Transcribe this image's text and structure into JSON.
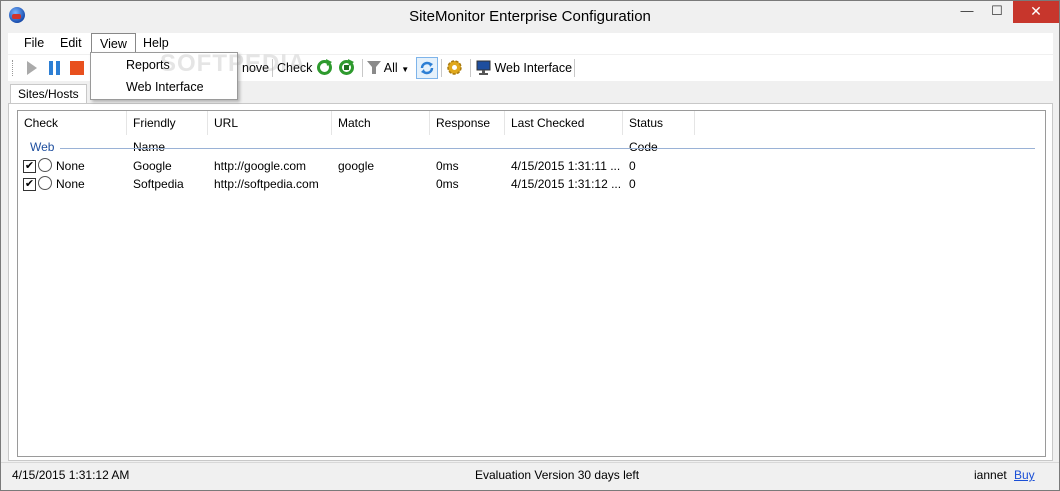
{
  "window": {
    "title": "SiteMonitor Enterprise Configuration",
    "minimize_glyph": "—",
    "maximize_glyph": "☐",
    "close_glyph": "✕"
  },
  "menu": {
    "file": "File",
    "edit": "Edit",
    "view": "View",
    "help": "Help"
  },
  "view_menu": {
    "items": [
      "Reports",
      "Web Interface"
    ]
  },
  "toolbar": {
    "remove_partial": "nove",
    "check": "Check",
    "filter": "All",
    "web_interface": "Web Interface"
  },
  "tabs": {
    "sites": "Sites/Hosts"
  },
  "table": {
    "columns": [
      "Check",
      "Friendly Name",
      "URL",
      "Match",
      "Response",
      "Last Checked",
      "Status Code"
    ],
    "group": "Web",
    "rows": [
      {
        "checked": true,
        "check": "None",
        "name": "Google",
        "url": "http://google.com",
        "match": "google",
        "response": "0ms",
        "last_checked": "4/15/2015 1:31:11 ...",
        "status": "0"
      },
      {
        "checked": true,
        "check": "None",
        "name": "Softpedia",
        "url": "http://softpedia.com",
        "match": "",
        "response": "0ms",
        "last_checked": "4/15/2015 1:31:12 ...",
        "status": "0"
      }
    ]
  },
  "status": {
    "time": "4/15/2015 1:31:12 AM",
    "eval": "Evaluation Version 30 days left",
    "user": "iannet",
    "buy": "Buy"
  },
  "watermark": "SOFTPEDIA",
  "colors": {
    "accent": "#1e4e9e",
    "close": "#c7362c",
    "play": "#aaaaaa",
    "pause": "#2d7fd4",
    "stop": "#e8501e",
    "refresh": "#2e9a2e",
    "gear": "#e0a81c"
  },
  "icons": [
    "app-globe-icon",
    "play-icon",
    "pause-icon",
    "stop-icon",
    "refresh-icon",
    "refresh-all-icon",
    "filter-icon",
    "sync-icon",
    "settings-gear-icon",
    "monitor-icon"
  ]
}
